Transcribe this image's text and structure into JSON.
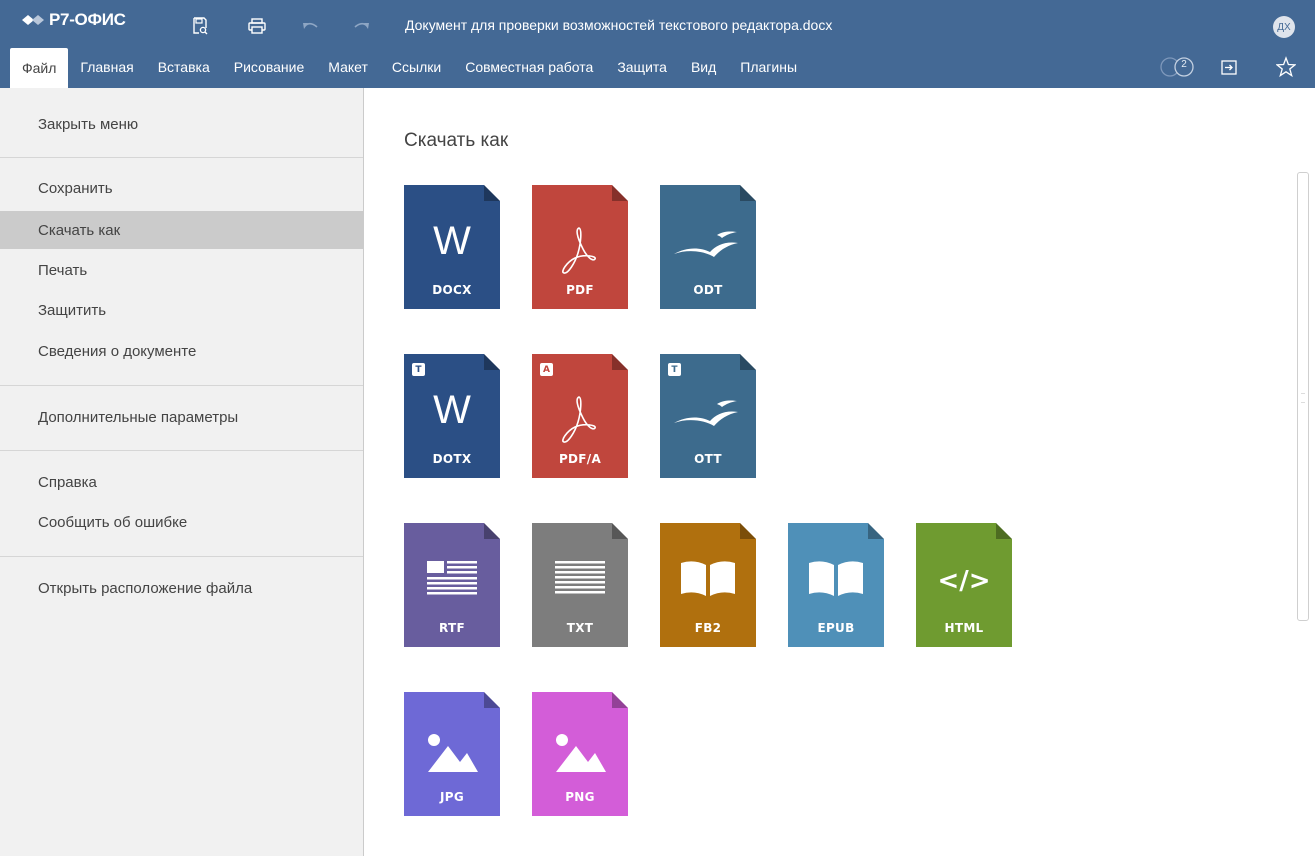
{
  "app": {
    "logo_text": "Р7-ОФИС",
    "document_title": "Документ для проверки возможностей текстового редактора.docx",
    "avatar_initials": "ДХ",
    "coauthors_count": "2"
  },
  "colors": {
    "header_bg": "#446995",
    "panel_bg": "#f1f1f1",
    "active_item": "#cbcbcb"
  },
  "tabs": [
    {
      "label": "Файл",
      "active": true
    },
    {
      "label": "Главная"
    },
    {
      "label": "Вставка"
    },
    {
      "label": "Рисование"
    },
    {
      "label": "Макет"
    },
    {
      "label": "Ссылки"
    },
    {
      "label": "Совместная работа"
    },
    {
      "label": "Защита"
    },
    {
      "label": "Вид"
    },
    {
      "label": "Плагины"
    }
  ],
  "menu": {
    "close": "Закрыть меню",
    "save": "Сохранить",
    "download_as": "Скачать как",
    "print": "Печать",
    "protect": "Защитить",
    "info": "Сведения о документе",
    "advanced": "Дополнительные параметры",
    "help": "Справка",
    "report": "Сообщить об ошибке",
    "open_location": "Открыть расположение файла"
  },
  "main": {
    "title": "Скачать как",
    "formats": [
      {
        "label": "DOCX",
        "color": "#2b4f85",
        "icon": "word-w"
      },
      {
        "label": "PDF",
        "color": "#c0463d",
        "icon": "acrobat"
      },
      {
        "label": "ODT",
        "color": "#3d6b8d",
        "icon": "gull"
      },
      {
        "label": "DOTX",
        "color": "#2b4f85",
        "icon": "word-w",
        "badge": "T"
      },
      {
        "label": "PDF/A",
        "color": "#c0463d",
        "icon": "acrobat",
        "badge": "A"
      },
      {
        "label": "OTT",
        "color": "#3d6b8d",
        "icon": "gull",
        "badge": "T"
      },
      {
        "label": "RTF",
        "color": "#685d9e",
        "icon": "rich-text"
      },
      {
        "label": "TXT",
        "color": "#7d7d7d",
        "icon": "plain-text"
      },
      {
        "label": "FB2",
        "color": "#b0700e",
        "icon": "book"
      },
      {
        "label": "EPUB",
        "color": "#4f90b8",
        "icon": "book"
      },
      {
        "label": "HTML",
        "color": "#6f9b30",
        "icon": "code-brackets"
      },
      {
        "label": "JPG",
        "color": "#6e69d6",
        "icon": "image"
      },
      {
        "label": "PNG",
        "color": "#d35dd8",
        "icon": "image"
      }
    ]
  },
  "glyphs": {
    "word": "W",
    "html": "</>"
  }
}
